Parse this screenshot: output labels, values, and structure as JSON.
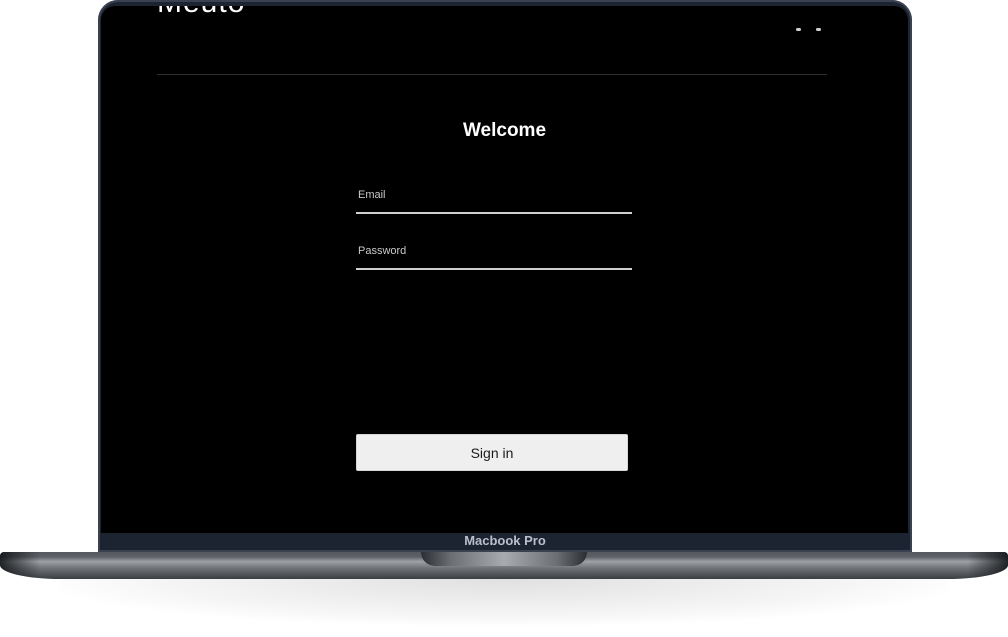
{
  "app": {
    "brand": "Meuto"
  },
  "login": {
    "title": "Welcome",
    "email_placeholder": "Email",
    "password_placeholder": "Password",
    "submit_label": "Sign in"
  },
  "device": {
    "label": "Macbook Pro"
  },
  "colors": {
    "screen_background": "#000000",
    "button_background": "#efefef",
    "field_underline": "#cfcfcf",
    "bezel": "#1c2331"
  }
}
